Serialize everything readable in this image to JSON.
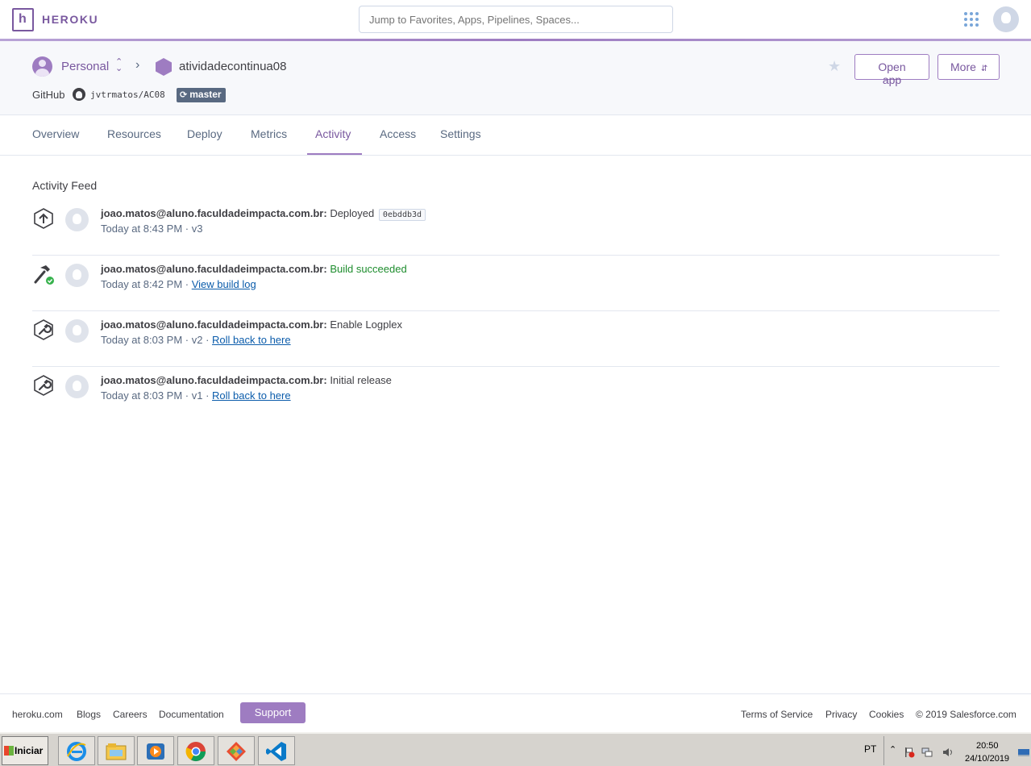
{
  "topnav": {
    "brand": "HEROKU",
    "search_placeholder": "Jump to Favorites, Apps, Pipelines, Spaces..."
  },
  "app_header": {
    "account": "Personal",
    "app_name": "atividadecontinua08",
    "github_label": "GitHub",
    "repo": "jvtrmatos/AC08",
    "branch": "master",
    "open_app_label": "Open app",
    "more_label": "More"
  },
  "tabs": [
    {
      "label": "Overview",
      "active": false
    },
    {
      "label": "Resources",
      "active": false
    },
    {
      "label": "Deploy",
      "active": false
    },
    {
      "label": "Metrics",
      "active": false
    },
    {
      "label": "Activity",
      "active": true
    },
    {
      "label": "Access",
      "active": false
    },
    {
      "label": "Settings",
      "active": false
    }
  ],
  "activity": {
    "title": "Activity Feed",
    "items": [
      {
        "icon": "deploy-upload-icon",
        "user": "joao.matos@aluno.faculdadeimpacta.com.br:",
        "action": "Deployed",
        "sha": "0ebddb3d",
        "time": "Today at 8:43 PM",
        "version": "v3"
      },
      {
        "icon": "build-hammer-icon",
        "user": "joao.matos@aluno.faculdadeimpacta.com.br:",
        "action": "Build succeeded",
        "time": "Today at 8:42 PM",
        "link": "View build log"
      },
      {
        "icon": "wrench-icon",
        "user": "joao.matos@aluno.faculdadeimpacta.com.br:",
        "action": "Enable Logplex",
        "time": "Today at 8:03 PM",
        "version": "v2",
        "link": "Roll back to here"
      },
      {
        "icon": "wrench-icon",
        "user": "joao.matos@aluno.faculdadeimpacta.com.br:",
        "action": "Initial release",
        "time": "Today at 8:03 PM",
        "version": "v1",
        "link": "Roll back to here"
      }
    ]
  },
  "footer": {
    "links_left": [
      "heroku.com",
      "Blogs",
      "Careers",
      "Documentation"
    ],
    "support_label": "Support",
    "links_right": [
      "Terms of Service",
      "Privacy",
      "Cookies"
    ],
    "copyright": "© 2019 Salesforce.com"
  },
  "taskbar": {
    "start_label": "Iniciar",
    "language": "PT",
    "time": "20:50",
    "date": "24/10/2019",
    "apps": [
      "internet-explorer-icon",
      "file-explorer-icon",
      "media-player-icon",
      "chrome-icon",
      "git-icon",
      "vscode-icon"
    ]
  },
  "colors": {
    "brand_purple": "#79589f",
    "accent_purple": "#9e7cc1",
    "success_green": "#1e8d2e",
    "link_blue": "#0b5cab"
  }
}
